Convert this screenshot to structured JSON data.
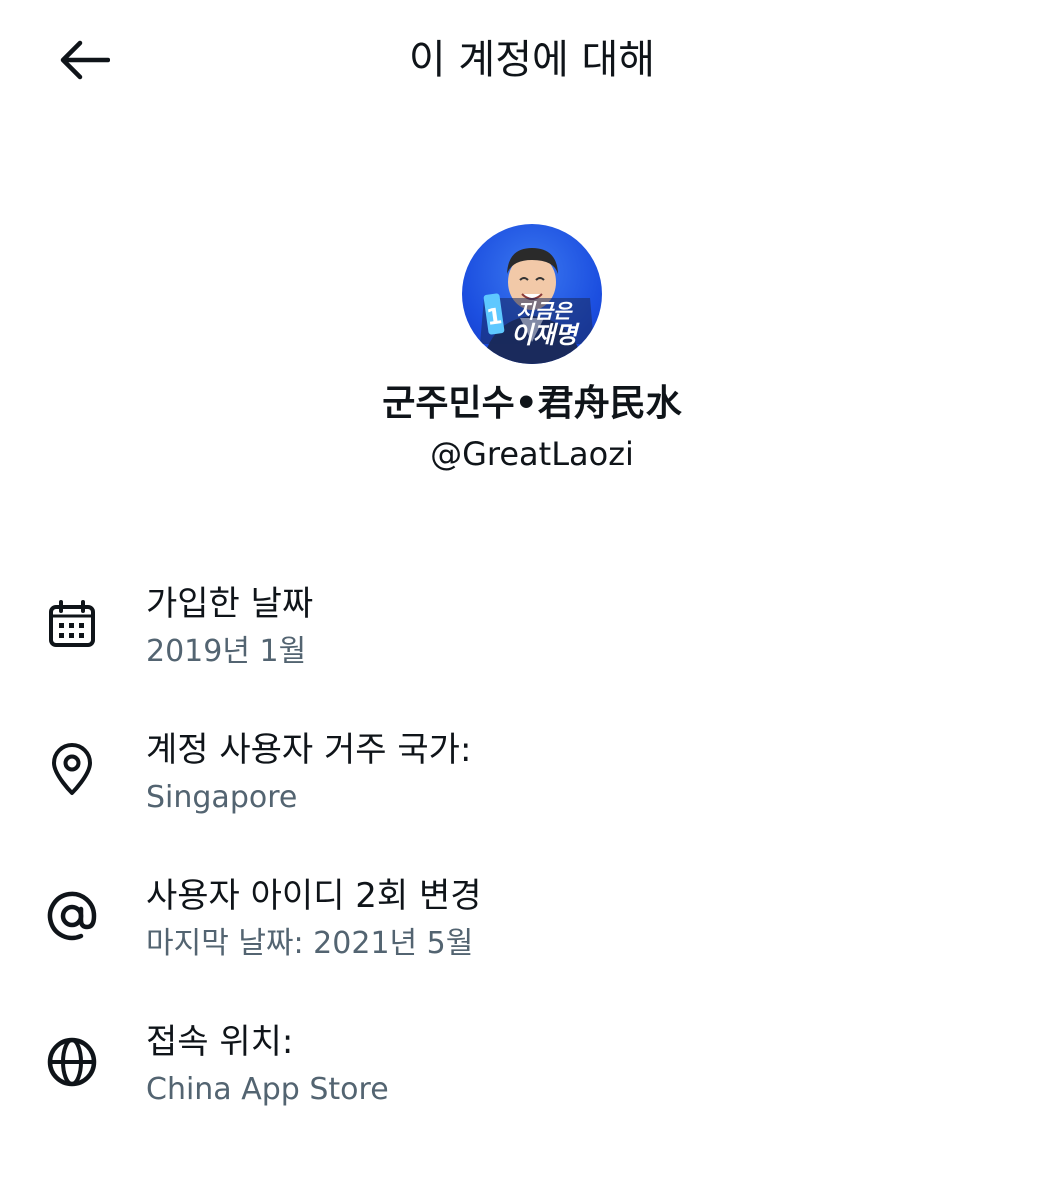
{
  "header": {
    "back_icon": "arrow-left-icon",
    "title": "이 계정에 대해"
  },
  "profile": {
    "avatar_caption_line1": "지금은",
    "avatar_caption_line2": "이재명",
    "avatar_badge_number": "1",
    "display_name": "군주민수•君舟民水",
    "handle": "@GreatLaozi"
  },
  "info": [
    {
      "icon": "calendar-icon",
      "title": "가입한 날짜",
      "value": "2019년 1월"
    },
    {
      "icon": "location-pin-icon",
      "title": "계정 사용자 거주 국가:",
      "value": "Singapore"
    },
    {
      "icon": "at-sign-icon",
      "title": "사용자 아이디 2회 변경",
      "value": "마지막 날짜: 2021년 5월"
    },
    {
      "icon": "globe-icon",
      "title": "접속 위치:",
      "value": "China App Store"
    }
  ],
  "colors": {
    "text_primary": "#0f1419",
    "text_secondary": "#536471",
    "avatar_blue": "#1c4fe0"
  }
}
